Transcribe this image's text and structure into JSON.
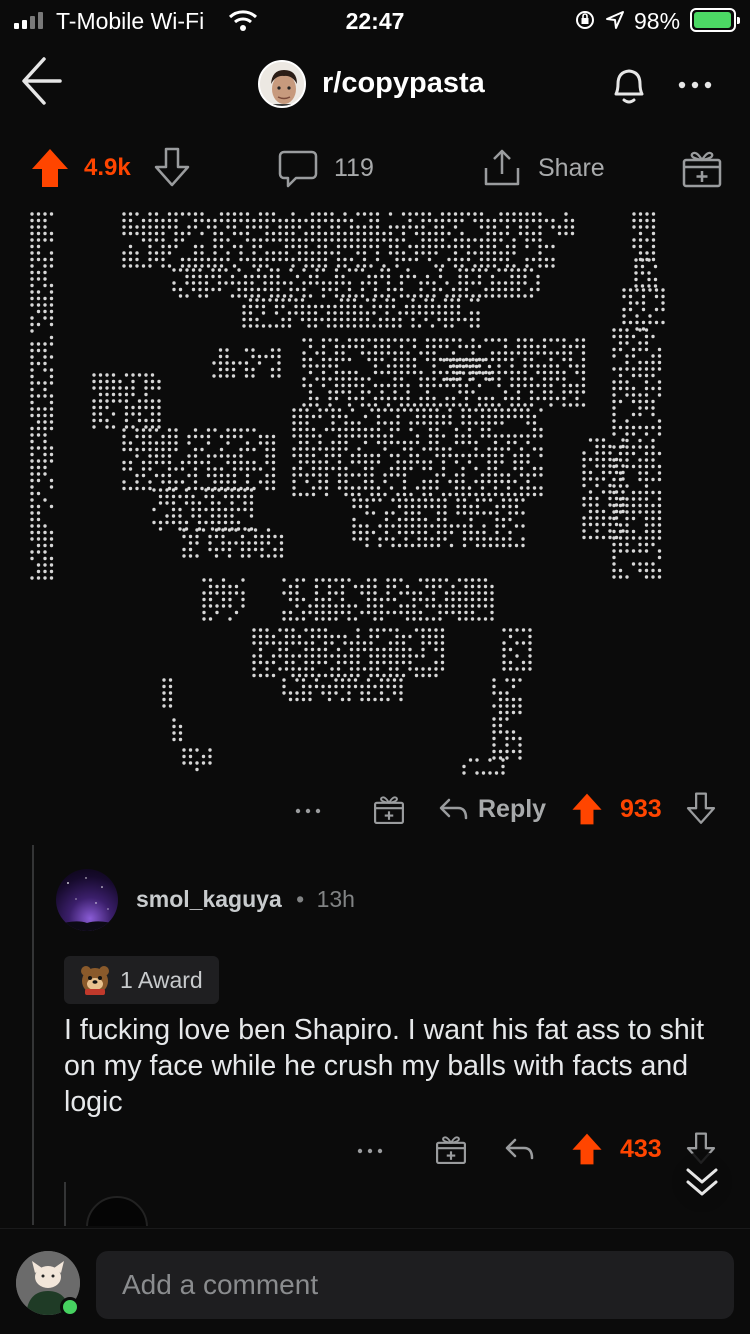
{
  "status_bar": {
    "carrier": "T-Mobile Wi-Fi",
    "time": "22:47",
    "battery_pct": "98%",
    "battery_level": 0.98
  },
  "header": {
    "subreddit": "r/copypasta"
  },
  "post": {
    "upvotes": "4.9k",
    "comments": "119",
    "share_label": "Share",
    "comment_actions": {
      "reply_label": "Reply",
      "score": "933"
    }
  },
  "comment": {
    "username": "smol_kaguya",
    "separator": "•",
    "age": "13h",
    "award_label": "1 Award",
    "body": "I fucking love ben Shapiro. I want his fat ass to shit on my face while he crush my balls with facts and logic",
    "score": "433"
  },
  "compose": {
    "placeholder": "Add a comment"
  },
  "colors": {
    "upvote": "#ff4500",
    "background": "#0b0b0b",
    "muted": "#818384",
    "online": "#46d160"
  },
  "icons": [
    "back-arrow-icon",
    "bell-icon",
    "more-icon",
    "upvote-icon",
    "downvote-icon",
    "comment-icon",
    "share-icon",
    "award-icon",
    "reply-icon",
    "chevron-double-down-icon"
  ]
}
